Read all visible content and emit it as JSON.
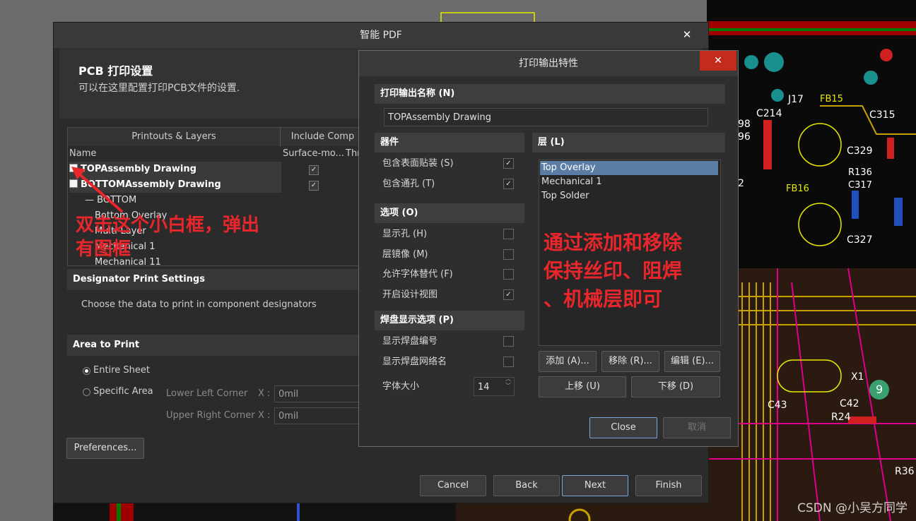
{
  "main_dialog": {
    "title": "智能 PDF",
    "close": "✕",
    "header_title": "PCB 打印设置",
    "header_sub": "可以在这里配置打印PCB文件的设置.",
    "tree": {
      "col_printouts": "Printouts & Layers",
      "col_include": "Include Comp",
      "sub_name": "Name",
      "sub_surface": "Surface-mo...",
      "sub_thru": "Thr",
      "rows": [
        {
          "label": "TOPAssembly Drawing",
          "checked": true
        },
        {
          "label": "BOTTOMAssembly Drawing",
          "checked": true
        },
        {
          "label": "BOTTOM"
        },
        {
          "label": "Bottom Overlay"
        },
        {
          "label": "Multi-Layer"
        },
        {
          "label": "Mechanical 1"
        },
        {
          "label": "Mechanical 11"
        }
      ]
    },
    "designator_section": "Designator Print Settings",
    "designator_text": "Choose the data to print in component designators",
    "area_section": "Area to Print",
    "entire_sheet": "Entire Sheet",
    "specific_area": "Specific Area",
    "lower_left": "Lower Left Corner",
    "upper_right": "Upper Right Corner",
    "x_label": "X :",
    "lower_x": "0mil",
    "upper_x": "0mil",
    "preferences": "Preferences...",
    "cancel": "Cancel",
    "back": "Back",
    "next": "Next",
    "finish": "Finish"
  },
  "sub_dialog": {
    "title": "打印输出特性",
    "close": "✕",
    "name_section": "打印输出名称 (N)",
    "name_value": "TOPAssembly Drawing",
    "parts_section": "器件",
    "include_smd": "包含表面贴装 (S)",
    "include_smd_checked": true,
    "include_thru": "包含通孔 (T)",
    "include_thru_checked": true,
    "options_section": "选项 (O)",
    "show_holes": "显示孔 (H)",
    "show_holes_checked": false,
    "mirror": "层镜像 (M)",
    "mirror_checked": false,
    "font_sub": "允许字体替代 (F)",
    "font_sub_checked": false,
    "design_view": "开启设计视图",
    "design_view_checked": true,
    "pad_section": "焊盘显示选项 (P)",
    "pad_numbers": "显示焊盘编号",
    "pad_numbers_checked": false,
    "pad_nets": "显示焊盘网络名",
    "pad_nets_checked": false,
    "font_size_label": "字体大小",
    "font_size_value": "14",
    "layers_section": "层 (L)",
    "layers": [
      "Top Overlay",
      "Mechanical 1",
      "Top Solder"
    ],
    "add": "添加 (A)...",
    "remove": "移除 (R)...",
    "edit": "编辑 (E)...",
    "move_up": "上移 (U)",
    "move_down": "下移 (D)",
    "close_btn": "Close",
    "cancel_btn": "取消"
  },
  "annotations": {
    "left": [
      "双击这个小白框，弹出",
      "有图框"
    ],
    "right": [
      "通过添加和移除",
      "保持丝印、阻焊",
      "、机械层即可"
    ]
  },
  "pcb_labels": [
    "J17",
    "C214",
    "FB15",
    "C315",
    "98",
    "96",
    "C329",
    "R136",
    "C317",
    "FB16",
    "C327",
    "X1",
    "C43",
    "C42",
    "R24",
    "9",
    "R36",
    "2"
  ],
  "watermark": "CSDN @小吴方同学",
  "colors": {
    "accent_red": "#e8262b",
    "selection": "#5a7da6",
    "close_red": "#c42b1c"
  }
}
